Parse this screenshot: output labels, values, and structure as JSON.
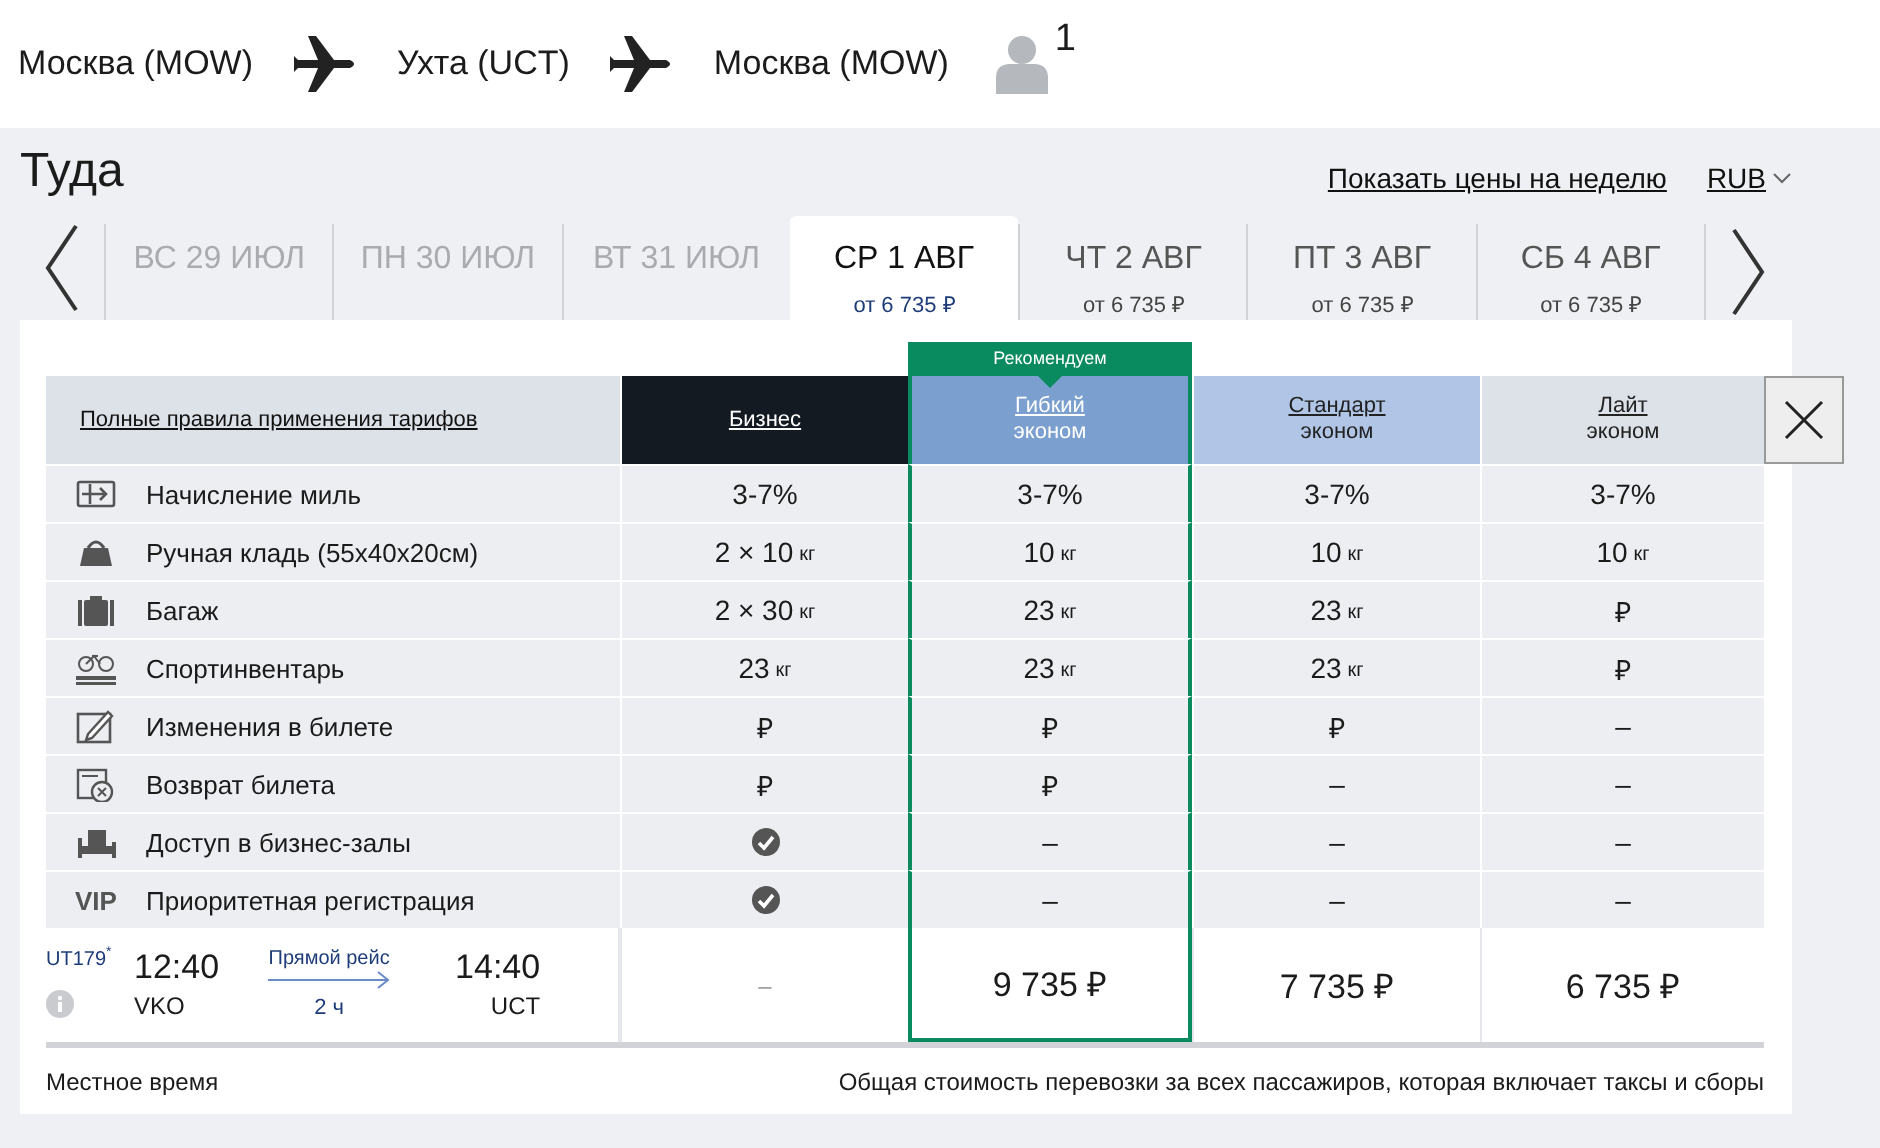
{
  "route": {
    "stops": [
      "Москва (MOW)",
      "Ухта (UCT)",
      "Москва (MOW)"
    ],
    "passengers": "1"
  },
  "direction": {
    "title": "Туда",
    "week_link": "Показать цены на неделю",
    "currency": "RUB"
  },
  "days": [
    {
      "label": "ВС 29 ИЮЛ",
      "disabled": true,
      "selected": false
    },
    {
      "label": "ПН 30 ИЮЛ",
      "disabled": true,
      "selected": false
    },
    {
      "label": "ВТ 31 ИЮЛ",
      "disabled": true,
      "selected": false
    },
    {
      "label": "СР 1 АВГ",
      "price": "от 6 735 ₽",
      "disabled": false,
      "selected": true
    },
    {
      "label": "ЧТ 2 АВГ",
      "price": "от 6 735 ₽",
      "disabled": false,
      "selected": false
    },
    {
      "label": "ПТ 3 АВГ",
      "price": "от 6 735 ₽",
      "disabled": false,
      "selected": false
    },
    {
      "label": "СБ 4 АВГ",
      "price": "от 6 735 ₽",
      "disabled": false,
      "selected": false
    }
  ],
  "fares": {
    "rules_link": "Полные правила применения тарифов",
    "columns": [
      {
        "name": "Бизнес",
        "color": "#131a22",
        "selected": false
      },
      {
        "name": "Гибкий",
        "subtitle": "эконом",
        "badge": "Рекомендуем",
        "color": "#7b9fce",
        "selected": true
      },
      {
        "name": "Стандарт",
        "subtitle": "эконом",
        "color": "#b1c6e6",
        "selected": false
      },
      {
        "name": "Лайт",
        "subtitle": "эконом",
        "color": "#dde1e8",
        "selected": false
      }
    ],
    "features": [
      {
        "label": "Начисление миль",
        "values": [
          {
            "text": "3-7%"
          },
          {
            "text": "3-7%"
          },
          {
            "text": "3-7%"
          },
          {
            "text": "3-7%"
          }
        ]
      },
      {
        "label": "Ручная кладь (55x40x20см)",
        "values": [
          {
            "text": "2 × 10",
            "unit": "кг"
          },
          {
            "text": "10",
            "unit": "кг"
          },
          {
            "text": "10",
            "unit": "кг"
          },
          {
            "text": "10",
            "unit": "кг"
          }
        ]
      },
      {
        "label": "Багаж",
        "values": [
          {
            "text": "2 × 30",
            "unit": "кг"
          },
          {
            "text": "23",
            "unit": "кг"
          },
          {
            "text": "23",
            "unit": "кг"
          },
          {
            "text": "₽"
          }
        ]
      },
      {
        "label": "Спортинвентарь",
        "values": [
          {
            "text": "23",
            "unit": "кг"
          },
          {
            "text": "23",
            "unit": "кг"
          },
          {
            "text": "23",
            "unit": "кг"
          },
          {
            "text": "₽"
          }
        ]
      },
      {
        "label": "Изменения в билете",
        "values": [
          {
            "text": "₽"
          },
          {
            "text": "₽"
          },
          {
            "text": "₽"
          },
          {
            "text": "–"
          }
        ]
      },
      {
        "label": "Возврат билета",
        "values": [
          {
            "text": "₽"
          },
          {
            "text": "₽"
          },
          {
            "text": "–"
          },
          {
            "text": "–"
          }
        ]
      },
      {
        "label": "Доступ в бизнес-залы",
        "values": [
          {
            "kind": "check"
          },
          {
            "text": "–"
          },
          {
            "text": "–"
          },
          {
            "text": "–"
          }
        ]
      },
      {
        "label": "Приоритетная регистрация",
        "badge": "VIP",
        "values": [
          {
            "kind": "check"
          },
          {
            "text": "–"
          },
          {
            "text": "–"
          },
          {
            "text": "–"
          }
        ]
      }
    ],
    "flight": {
      "number": "UT179$^{*}$",
      "departure_time": "12:40",
      "departure_airport": "VKO",
      "type": "Прямой рейс",
      "duration": "2 ч",
      "arrival_time": "14:40",
      "arrival_airport": "UCT",
      "prices": [
        "–",
        "9 735 ₽",
        "7 735 ₽",
        "6 735 ₽"
      ]
    }
  },
  "footer": {
    "note": "Местное время",
    "total_note": "Общая стоимость перевозки за всех пассажиров, которая включает таксы и сборы"
  }
}
